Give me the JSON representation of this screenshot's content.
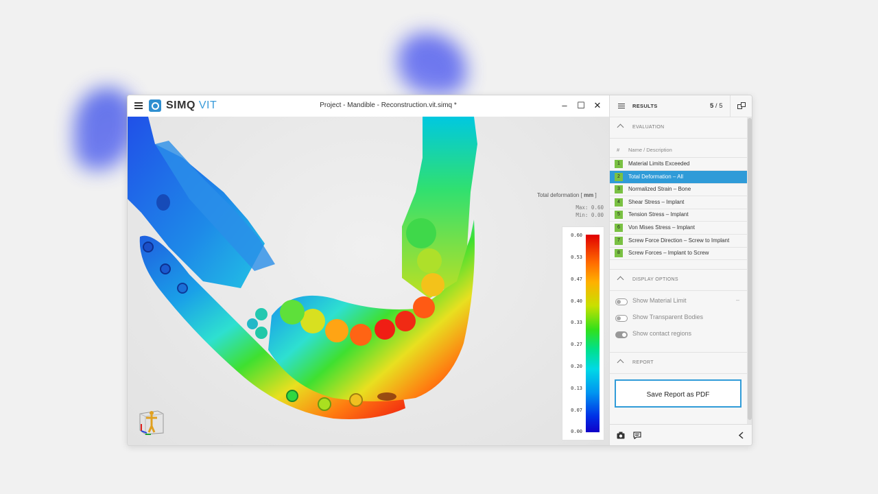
{
  "app": {
    "logo_primary": "SIMQ",
    "logo_secondary": "VIT",
    "document_title": "Project - Mandible - Reconstruction.vit.simq *"
  },
  "window_controls": {
    "minimize": "–",
    "maximize": "☐",
    "close": "✕"
  },
  "legend": {
    "title": "Total deformation",
    "unit_open": "[ ",
    "unit": "mm",
    "unit_close": " ]",
    "max_label": "Max: 0.60",
    "min_label": "Min: 0.00",
    "ticks": [
      "0.60",
      "0.53",
      "0.47",
      "0.40",
      "0.33",
      "0.27",
      "0.20",
      "0.13",
      "0.07",
      "0.00"
    ]
  },
  "panel": {
    "title": "RESULTS",
    "counter_current": "5",
    "counter_sep": " / ",
    "counter_total": "5",
    "evaluation": {
      "header": "EVALUATION",
      "col_hash": "#",
      "col_name": "Name / Description",
      "items": [
        {
          "num": "1",
          "label": "Material Limits Exceeded"
        },
        {
          "num": "2",
          "label": "Total Deformation – All",
          "selected": true
        },
        {
          "num": "3",
          "label": "Normalized Strain – Bone"
        },
        {
          "num": "4",
          "label": "Shear Stress – Implant"
        },
        {
          "num": "5",
          "label": "Tension Stress – Implant"
        },
        {
          "num": "6",
          "label": "Von Mises Stress – Implant"
        },
        {
          "num": "7",
          "label": "Screw Force Direction – Screw to Implant"
        },
        {
          "num": "8",
          "label": "Screw Forces – Implant to Screw"
        }
      ]
    },
    "display_options": {
      "header": "DISPLAY OPTIONS",
      "items": [
        {
          "label": "Show Material Limit",
          "on": false,
          "suffix": "–"
        },
        {
          "label": "Show Transparent Bodies",
          "on": false
        },
        {
          "label": "Show contact regions",
          "on": true
        }
      ]
    },
    "report": {
      "header": "REPORT",
      "save_button": "Save Report as PDF"
    }
  },
  "icons": {
    "menu": "hamburger-icon",
    "logo": "simq-logo-icon",
    "list": "list-icon",
    "detach": "detach-window-icon",
    "camera": "camera-icon",
    "comment": "comment-icon",
    "collapse": "chevron-left-icon",
    "orientation": "orientation-cube-icon"
  },
  "colors": {
    "accent": "#2f9bd8",
    "badge": "#7ac143"
  }
}
